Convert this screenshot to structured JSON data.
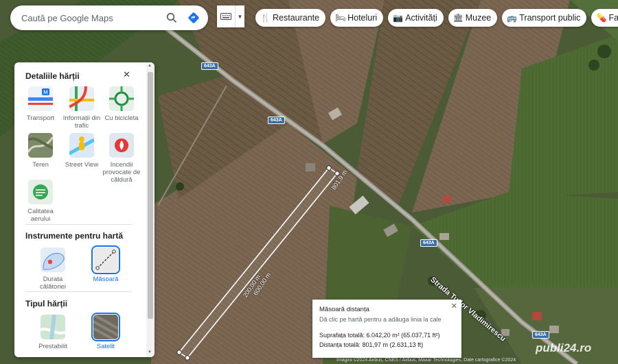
{
  "search": {
    "placeholder": "Caută pe Google Maps"
  },
  "chips": [
    {
      "icon": "fork-knife-icon",
      "glyph": "🍴",
      "label": "Restaurante"
    },
    {
      "icon": "bed-icon",
      "glyph": "🛏",
      "label": "Hoteluri"
    },
    {
      "icon": "camera-icon",
      "glyph": "📷",
      "label": "Activități"
    },
    {
      "icon": "museum-icon",
      "glyph": "🏛",
      "label": "Muzee"
    },
    {
      "icon": "bus-icon",
      "glyph": "🚌",
      "label": "Transport public"
    },
    {
      "icon": "pharmacy-icon",
      "glyph": "💊",
      "label": "Farmacii"
    }
  ],
  "panel": {
    "details_title": "Detaliile hărții",
    "details": [
      {
        "name": "transit",
        "label": "Transport"
      },
      {
        "name": "traffic",
        "label": "Informații din trafic"
      },
      {
        "name": "bicycle",
        "label": "Cu bicicleta"
      },
      {
        "name": "terrain",
        "label": "Teren"
      },
      {
        "name": "street-view",
        "label": "Street View"
      },
      {
        "name": "wildfires",
        "label": "Incendii provocate de căldură"
      },
      {
        "name": "air-quality",
        "label": "Calitatea aerului"
      }
    ],
    "tools_title": "Instrumente pentru hartă",
    "tools": [
      {
        "name": "travel-time",
        "label": "Durata călătoriei",
        "selected": false
      },
      {
        "name": "measure",
        "label": "Măsoară",
        "selected": true
      }
    ],
    "type_title": "Tipul hărții",
    "types": [
      {
        "name": "default",
        "label": "Prestabilit",
        "selected": false
      },
      {
        "name": "satellite",
        "label": "Satelit",
        "selected": true
      }
    ]
  },
  "measure": {
    "title": "Măsoară distanța",
    "subtitle": "Dă clic pe hartă pentru a adăuga linia la cale",
    "area": "Suprafața totală: 6.042,20 m² (65.037,71 ft²)",
    "distance": "Distanța totală: 801,97 m (2.631,13 ft)"
  },
  "map": {
    "road_labels": [
      "643A",
      "643A",
      "643A",
      "643A"
    ],
    "street_name": "Strada Tudor Vladimirescu",
    "segment_labels": [
      "200,00 m",
      "600,00 m",
      "801,9 m"
    ],
    "copyright": "Imagini ©2024 Airbus, CNES / Airbus, Maxar Technologies, Date cartografice ©2024",
    "watermark": "publi24.ro"
  }
}
